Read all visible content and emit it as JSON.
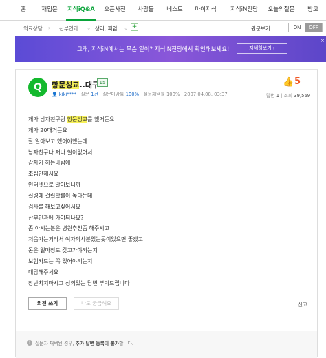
{
  "nav": {
    "tabs": [
      {
        "label": "홈"
      },
      {
        "label": "재입문"
      },
      {
        "label": "지식iQ&A"
      },
      {
        "label": "오픈사전"
      },
      {
        "label": "사람들"
      },
      {
        "label": "베스트"
      },
      {
        "label": "마이지식"
      },
      {
        "label": "지식iN전당"
      },
      {
        "label": "오늘의질문"
      },
      {
        "label": "방코"
      }
    ],
    "active_tab": "지식iQ&A"
  },
  "categories": {
    "items": [
      "의료상담",
      "산부인과",
      "생리, 피임"
    ],
    "plus": "+",
    "toggle_label": "원문보기",
    "toggle_on": "ON",
    "toggle_off": "OFF"
  },
  "banner": {
    "text": "그래, 지식iN에서는 무슨 일이? 지식iN전당에서 확인해보세요!",
    "button": "자세히보기 ›",
    "close": "×"
  },
  "question": {
    "icon": "Q",
    "title_highlight": "항문성교",
    "title_rest": "..대구",
    "grade": "15",
    "meta": {
      "author": "kiki****",
      "q_label": "질문",
      "q_count": "1건",
      "completion_label": "질문마감률",
      "completion": "100%",
      "adopt_label": "질문채택률",
      "adopt": "100%",
      "date": "2007.04.08. 03:37"
    },
    "likes": "5",
    "answers_label": "답변",
    "answers": "1",
    "views_label": "조회",
    "views": "39,569",
    "body_first_pre": "제가 남자친구랑 ",
    "body_first_hl": "항문성교",
    "body_first_post": "를 했거든요",
    "body": [
      "제가 20대거든요",
      "잘 알아보고 했어야했는데",
      "남자친구나 저나 철이없어서..",
      "갑자기 하는바람에",
      "조심안해서요",
      "인터넷으로 알아보니까",
      "질병에 걸릴확률이 높다는데",
      "검사를 해보고싶어서요",
      "산부인과에 가야되나요?",
      "좀 아시는분은 병원추천좀 해주시고",
      "처음가는거라서 여자의사분있는곳이었으면 좋겠고",
      "돈은 얼마정도 갖고가야되는지",
      "보험카드는 꼭 있어야되는지",
      "대답해주세요",
      "장난치지마시고 성의있는 답변 부탁드립니다"
    ]
  },
  "actions": {
    "reply": "의견 쓰기",
    "curious": "나도 궁금해요",
    "report": "신고"
  },
  "notice": {
    "icon": "!",
    "pre": "질문자 채택된 경우, ",
    "bold": "추가 답변 등록이 불가",
    "post": "합니다."
  },
  "colors": {
    "accent_green": "#0aa43a",
    "banner_purple": "#6b4fd8",
    "like_orange": "#f05a28",
    "highlight_yellow": "#f6f058"
  }
}
